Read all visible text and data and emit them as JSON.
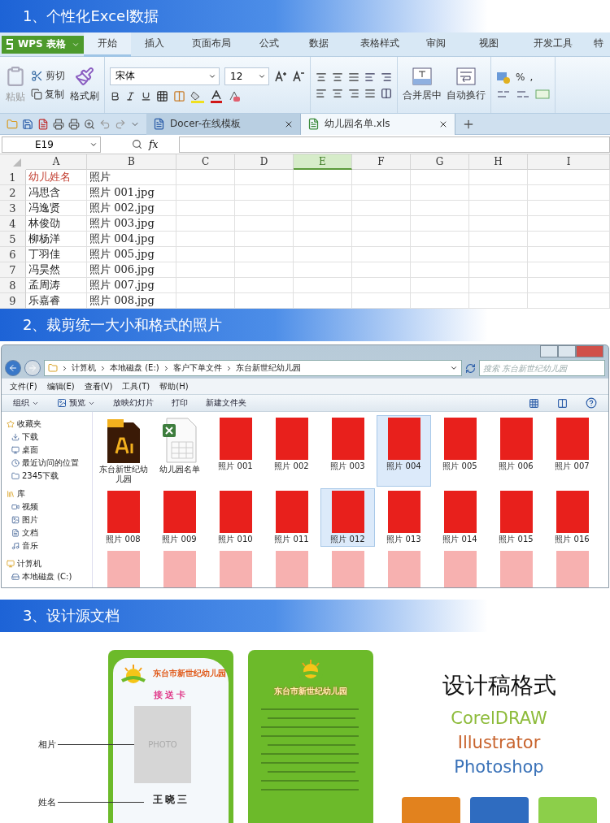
{
  "sections": [
    {
      "title": "1、个性化Excel数据"
    },
    {
      "title": "2、裁剪统一大小和格式的照片"
    },
    {
      "title": "3、设计源文档"
    }
  ],
  "spreadsheet": {
    "app_button": "WPS 表格",
    "menu_tabs": [
      {
        "label": "开始",
        "selected": true
      },
      {
        "label": "插入",
        "selected": false
      },
      {
        "label": "页面布局",
        "selected": false
      },
      {
        "label": "公式",
        "selected": false
      },
      {
        "label": "数据",
        "selected": false
      },
      {
        "label": "表格样式",
        "selected": false
      },
      {
        "label": "审阅",
        "selected": false
      },
      {
        "label": "视图",
        "selected": false
      },
      {
        "label": "开发工具",
        "selected": false
      },
      {
        "label": "特",
        "selected": false
      }
    ],
    "ribbon": {
      "paste": "粘贴",
      "cut": "剪切",
      "copy": "复制",
      "format_painter": "格式刷",
      "font": "宋体",
      "font_size": "12",
      "merge": "合并居中",
      "wrap": "自动换行",
      "percent": "%",
      "comma": ","
    },
    "doc_tabs": [
      {
        "label": "Docer-在线模板",
        "selected": false
      },
      {
        "label": "幼儿园名单.xls",
        "selected": true
      }
    ],
    "name_box": "E19",
    "fx": "fx",
    "columns": [
      {
        "label": "A",
        "selected": false
      },
      {
        "label": "B",
        "selected": false
      },
      {
        "label": "C",
        "selected": false
      },
      {
        "label": "D",
        "selected": false
      },
      {
        "label": "E",
        "selected": true
      },
      {
        "label": "F",
        "selected": false
      },
      {
        "label": "G",
        "selected": false
      },
      {
        "label": "H",
        "selected": false
      },
      {
        "label": "I",
        "selected": false
      }
    ],
    "rows": [
      {
        "number": "1",
        "kind": "header",
        "cells": [
          "幼儿姓名",
          "照片"
        ]
      },
      {
        "number": "2",
        "kind": "data",
        "cells": [
          "冯思含",
          "照片 001.jpg"
        ]
      },
      {
        "number": "3",
        "kind": "data",
        "cells": [
          "冯逸贤",
          "照片 002.jpg"
        ]
      },
      {
        "number": "4",
        "kind": "data",
        "cells": [
          "林俊劭",
          "照片 003.jpg"
        ]
      },
      {
        "number": "5",
        "kind": "data",
        "cells": [
          "柳杨洋",
          "照片 004.jpg"
        ]
      },
      {
        "number": "6",
        "kind": "data",
        "cells": [
          "丁羽佳",
          "照片 005.jpg"
        ]
      },
      {
        "number": "7",
        "kind": "data",
        "cells": [
          "冯昊然",
          "照片 006.jpg"
        ]
      },
      {
        "number": "8",
        "kind": "data",
        "cells": [
          "孟周涛",
          "照片 007.jpg"
        ]
      },
      {
        "number": "9",
        "kind": "data",
        "cells": [
          "乐嘉睿",
          "照片 008.jpg"
        ]
      }
    ]
  },
  "explorer": {
    "breadcrumbs": [
      "计算机",
      "本地磁盘 (E:)",
      "客户下单文件",
      "东台新世纪幼儿园"
    ],
    "search": {
      "placeholder": "搜索 东台新世纪幼儿园"
    },
    "menu": [
      "文件(F)",
      "编辑(E)",
      "查看(V)",
      "工具(T)",
      "帮助(H)"
    ],
    "toolbar": [
      {
        "label": "组织",
        "dropdown": true
      },
      {
        "label": "预览",
        "dropdown": true
      },
      {
        "label": "放映幻灯片",
        "dropdown": false
      },
      {
        "label": "打印",
        "dropdown": false
      },
      {
        "label": "新建文件夹",
        "dropdown": false
      }
    ],
    "nav": [
      {
        "label": "收藏夹",
        "children": [
          {
            "label": "下载"
          },
          {
            "label": "桌面"
          },
          {
            "label": "最近访问的位置"
          },
          {
            "label": "2345下载"
          }
        ]
      },
      {
        "label": "库",
        "children": [
          {
            "label": "视频"
          },
          {
            "label": "图片"
          },
          {
            "label": "文档"
          },
          {
            "label": "音乐"
          }
        ]
      },
      {
        "label": "计算机",
        "children": [
          {
            "label": "本地磁盘 (C:)"
          }
        ]
      }
    ],
    "files": [
      {
        "kind": "ai",
        "name": "东台新世纪幼儿园",
        "selected": false
      },
      {
        "kind": "xls",
        "name": "幼儿园名单",
        "selected": false
      },
      {
        "kind": "photo",
        "name": "照片 001",
        "selected": false
      },
      {
        "kind": "photo",
        "name": "照片 002",
        "selected": false
      },
      {
        "kind": "photo",
        "name": "照片 003",
        "selected": false
      },
      {
        "kind": "photo",
        "name": "照片 004",
        "selected": true
      },
      {
        "kind": "photo",
        "name": "照片 005",
        "selected": false
      },
      {
        "kind": "photo",
        "name": "照片 006",
        "selected": false
      },
      {
        "kind": "photo",
        "name": "照片 007",
        "selected": false
      },
      {
        "kind": "photo",
        "name": "照片 008",
        "selected": false
      },
      {
        "kind": "photo",
        "name": "照片 009",
        "selected": false
      },
      {
        "kind": "photo",
        "name": "照片 010",
        "selected": false
      },
      {
        "kind": "photo",
        "name": "照片 011",
        "selected": false
      },
      {
        "kind": "photo",
        "name": "照片 012",
        "selected": true
      },
      {
        "kind": "photo",
        "name": "照片 013",
        "selected": false
      },
      {
        "kind": "photo",
        "name": "照片 014",
        "selected": false
      },
      {
        "kind": "photo",
        "name": "照片 015",
        "selected": false
      },
      {
        "kind": "photo",
        "name": "照片 016",
        "selected": false
      },
      {
        "kind": "photo",
        "selected": false
      },
      {
        "kind": "photo",
        "selected": false
      },
      {
        "kind": "photo",
        "selected": false
      },
      {
        "kind": "photo",
        "selected": false
      },
      {
        "kind": "photo",
        "selected": false
      },
      {
        "kind": "photo",
        "selected": false
      },
      {
        "kind": "photo",
        "selected": false
      },
      {
        "kind": "photo",
        "selected": false
      },
      {
        "kind": "photo",
        "selected": false
      }
    ]
  },
  "design": {
    "labels": [
      {
        "text": "相片"
      },
      {
        "text": "姓名"
      }
    ],
    "front_card": {
      "school": "东台市新世纪幼儿园",
      "card_title": "接送卡",
      "photo_text": "PHOTO",
      "name": "王晓三"
    },
    "back_card": {
      "school": "东台市新世纪幼儿园"
    },
    "formats": {
      "title": "设计稿格式",
      "items": [
        {
          "name": "CorelDRAW",
          "color": "#8dbb3a"
        },
        {
          "name": "Illustrator",
          "color": "#c8642e"
        },
        {
          "name": "Photoshop",
          "color": "#3a72b8"
        }
      ]
    }
  }
}
